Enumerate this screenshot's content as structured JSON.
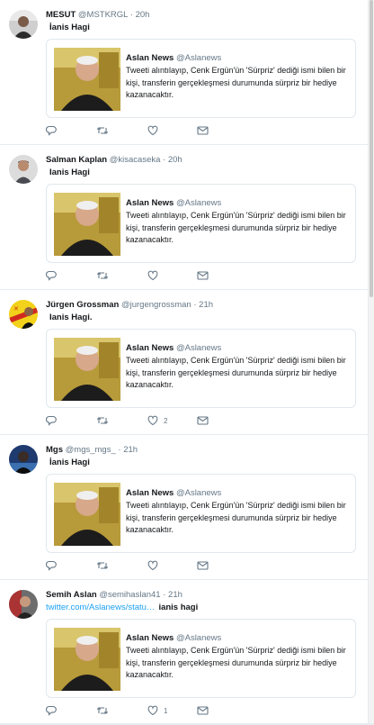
{
  "tweets": [
    {
      "name": "MESUT",
      "handle": "@MSTKRGL",
      "separator": "·",
      "time": "20h",
      "link": "",
      "text": "İanis Hagi",
      "reply_count": "",
      "retweet_count": "",
      "like_count": ""
    },
    {
      "name": "Salman Kaplan",
      "handle": "@kisacaseka",
      "separator": "·",
      "time": "20h",
      "link": "",
      "text": "Ianis Hagi",
      "reply_count": "",
      "retweet_count": "",
      "like_count": ""
    },
    {
      "name": "Jürgen Grossman",
      "handle": "@jurgengrossman",
      "separator": "·",
      "time": "21h",
      "link": "",
      "text": "Ianis Hagi.",
      "reply_count": "",
      "retweet_count": "",
      "like_count": "2"
    },
    {
      "name": "Mgs",
      "handle": "@mgs_mgs_",
      "separator": "·",
      "time": "21h",
      "link": "",
      "text": "İanis Hagi",
      "reply_count": "",
      "retweet_count": "",
      "like_count": ""
    },
    {
      "name": "Semih Aslan",
      "handle": "@semihaslan41",
      "separator": "·",
      "time": "21h",
      "link": "twitter.com/Aslanews/statu…",
      "text": "ianis hagi",
      "reply_count": "",
      "retweet_count": "",
      "like_count": "1"
    }
  ],
  "quote": {
    "name": "Aslan News",
    "handle": "@Aslanews",
    "text": "Tweeti alıntılayıp, Cenk Ergün'ün 'Sürpriz' dediği ismi bilen bir kişi, transferin gerçekleşmesi durumunda sürpriz bir hediye kazanacaktır."
  },
  "colors": {
    "link": "#1da1f2",
    "secondary_text": "#657786",
    "border": "#e1e8ed"
  },
  "icons": [
    "reply-icon",
    "retweet-icon",
    "like-icon",
    "message-icon"
  ]
}
